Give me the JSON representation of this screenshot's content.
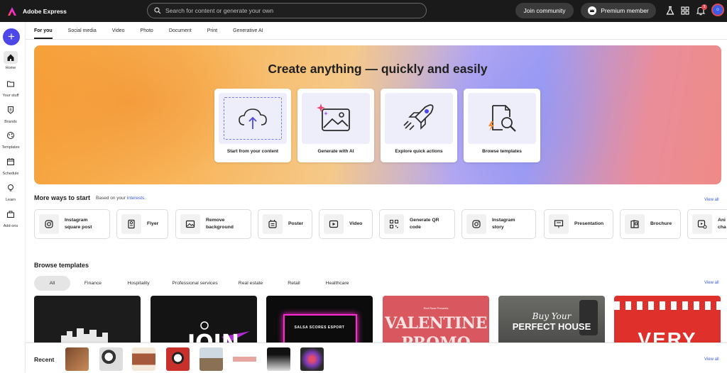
{
  "app": {
    "name": "Adobe Express"
  },
  "search": {
    "placeholder": "Search for content or generate your own"
  },
  "header": {
    "join_label": "Join community",
    "premium_label": "Premium member",
    "notification_count": "3"
  },
  "sidebar": {
    "create_label": "+",
    "items": [
      {
        "label": "Home",
        "icon": "home-icon"
      },
      {
        "label": "Your stuff",
        "icon": "folder-icon"
      },
      {
        "label": "Brands",
        "icon": "brand-icon"
      },
      {
        "label": "Templates",
        "icon": "templates-icon"
      },
      {
        "label": "Schedule",
        "icon": "calendar-icon"
      },
      {
        "label": "Learn",
        "icon": "lightbulb-icon"
      },
      {
        "label": "Add-ons",
        "icon": "addons-icon"
      }
    ]
  },
  "tabs": [
    {
      "label": "For you",
      "active": true
    },
    {
      "label": "Social media"
    },
    {
      "label": "Video"
    },
    {
      "label": "Photo"
    },
    {
      "label": "Document"
    },
    {
      "label": "Print"
    },
    {
      "label": "Generative AI"
    }
  ],
  "hero": {
    "title": "Create anything — quickly and easily",
    "cards": [
      {
        "label": "Start from your content",
        "icon": "cloud-upload-icon"
      },
      {
        "label": "Generate with AI",
        "icon": "ai-image-icon"
      },
      {
        "label": "Explore quick actions",
        "icon": "rocket-icon"
      },
      {
        "label": "Browse templates",
        "icon": "template-search-icon"
      }
    ]
  },
  "more_ways": {
    "title": "More ways to start",
    "subtitle_prefix": "Based on your",
    "subtitle_link": "interests.",
    "view_all": "View all",
    "items": [
      {
        "line1": "Instagram",
        "line2": "square post",
        "icon": "instagram-icon"
      },
      {
        "line1": "Flyer",
        "line2": "",
        "icon": "flyer-icon"
      },
      {
        "line1": "Remove",
        "line2": "background",
        "icon": "remove-background-icon"
      },
      {
        "line1": "Poster",
        "line2": "",
        "icon": "poster-icon"
      },
      {
        "line1": "Video",
        "line2": "",
        "icon": "video-icon"
      },
      {
        "line1": "Generate QR",
        "line2": "code",
        "icon": "qr-code-icon"
      },
      {
        "line1": "Instagram",
        "line2": "story",
        "icon": "instagram-icon"
      },
      {
        "line1": "Presentation",
        "line2": "",
        "icon": "presentation-icon"
      },
      {
        "line1": "Brochure",
        "line2": "",
        "icon": "brochure-icon"
      },
      {
        "line1": "Ani",
        "line2": "cha",
        "icon": "animate-icon"
      }
    ]
  },
  "browse": {
    "title": "Browse templates",
    "view_all": "View all",
    "filters": [
      "All",
      "Finance",
      "Hospitality",
      "Professional services",
      "Real estate",
      "Retail",
      "Healthcare"
    ],
    "templates": [
      {
        "text": "",
        "bg": "#1c1c1c"
      },
      {
        "text": "",
        "bg": "#141414"
      },
      {
        "text": "SALSA SCORES ESPORT",
        "bg": "#0c0c0c"
      },
      {
        "text": "VALENTINE",
        "text2": "PROMO",
        "small": "Red Rose Presents",
        "bg": "#d9585f"
      },
      {
        "text": "Buy Your",
        "text2": "PERFECT HOUSE",
        "bg": "#5a5a58"
      },
      {
        "text": "VERY",
        "bg": "#e0302b"
      }
    ]
  },
  "recent": {
    "label": "Recent",
    "view_all": "View all"
  },
  "colors": {
    "accent": "#4b47e8",
    "link": "#3b5bd9",
    "topbar": "#1a1a1a"
  }
}
